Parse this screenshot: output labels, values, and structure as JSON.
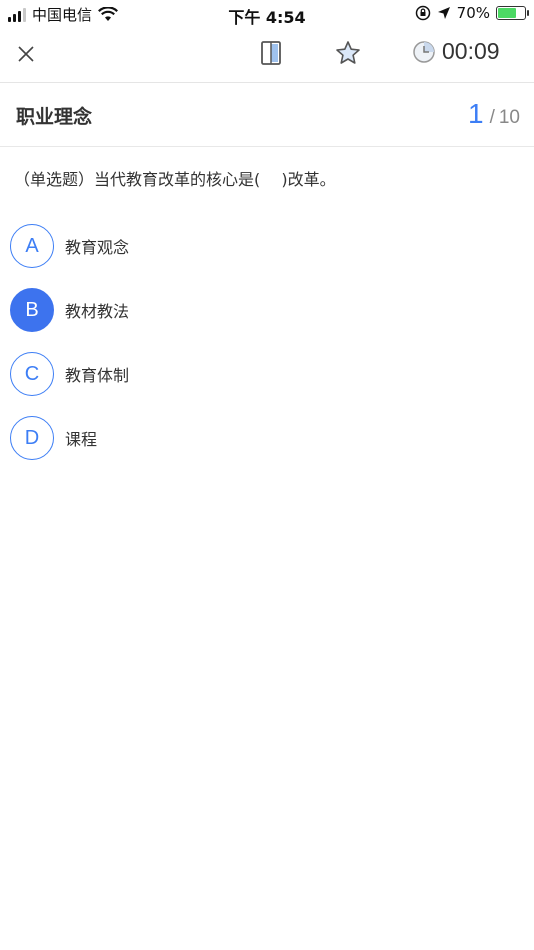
{
  "status_bar": {
    "carrier": "中国电信",
    "time": "下午 4:54",
    "battery": "70%",
    "battery_level": 0.7,
    "icons": [
      "signal-icon",
      "wifi-icon",
      "rotation-lock-icon",
      "location-icon",
      "battery-icon"
    ]
  },
  "nav": {
    "icons": [
      "close-icon",
      "answer-card-icon",
      "star-icon",
      "clock-icon"
    ],
    "timer": "00:09"
  },
  "header": {
    "title": "职业理念",
    "current": "1",
    "separator": "/",
    "total": "10"
  },
  "question": {
    "text": "（单选题）当代教育改革的核心是(　 )改革。",
    "options": [
      {
        "letter": "A",
        "text": "教育观念",
        "selected": false
      },
      {
        "letter": "B",
        "text": "教材教法",
        "selected": true
      },
      {
        "letter": "C",
        "text": "教育体制",
        "selected": false
      },
      {
        "letter": "D",
        "text": "课程",
        "selected": false
      }
    ]
  },
  "colors": {
    "accent": "#3d7ef5",
    "selected_fill": "#3d73ee",
    "text": "#333333",
    "battery_fill": "#4cd964"
  }
}
